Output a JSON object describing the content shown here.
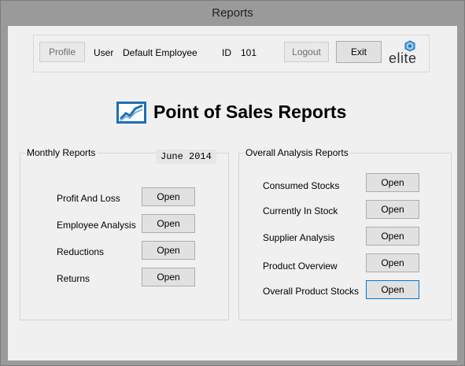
{
  "window": {
    "title": "Reports"
  },
  "top_panel": {
    "profile_button": "Profile",
    "user_label": "User",
    "user_value": "Default Employee",
    "id_label": "ID",
    "id_value": "101",
    "logout_button": "Logout",
    "exit_button": "Exit",
    "logo_text": "elite"
  },
  "heading": {
    "icon": "chart-trend-icon",
    "title": "Point of Sales Reports"
  },
  "monthly": {
    "title": "Monthly Reports",
    "date": "June 2014",
    "items": [
      {
        "label": "Profit And Loss",
        "button": "Open"
      },
      {
        "label": "Employee Analysis",
        "button": "Open"
      },
      {
        "label": "Reductions",
        "button": "Open"
      },
      {
        "label": "Returns",
        "button": "Open"
      }
    ]
  },
  "overall": {
    "title": "Overall Analysis Reports",
    "items": [
      {
        "label": "Consumed Stocks",
        "button": "Open"
      },
      {
        "label": "Currently In Stock",
        "button": "Open"
      },
      {
        "label": "Supplier Analysis",
        "button": "Open"
      },
      {
        "label": "Product Overview",
        "button": "Open"
      },
      {
        "label": "Overall Product Stocks",
        "button": "Open"
      }
    ]
  },
  "colors": {
    "accent": "#0078d7",
    "frame": "#9a9a9a",
    "client": "#f0f0f0",
    "icon_blue": "#1e6fb5"
  }
}
